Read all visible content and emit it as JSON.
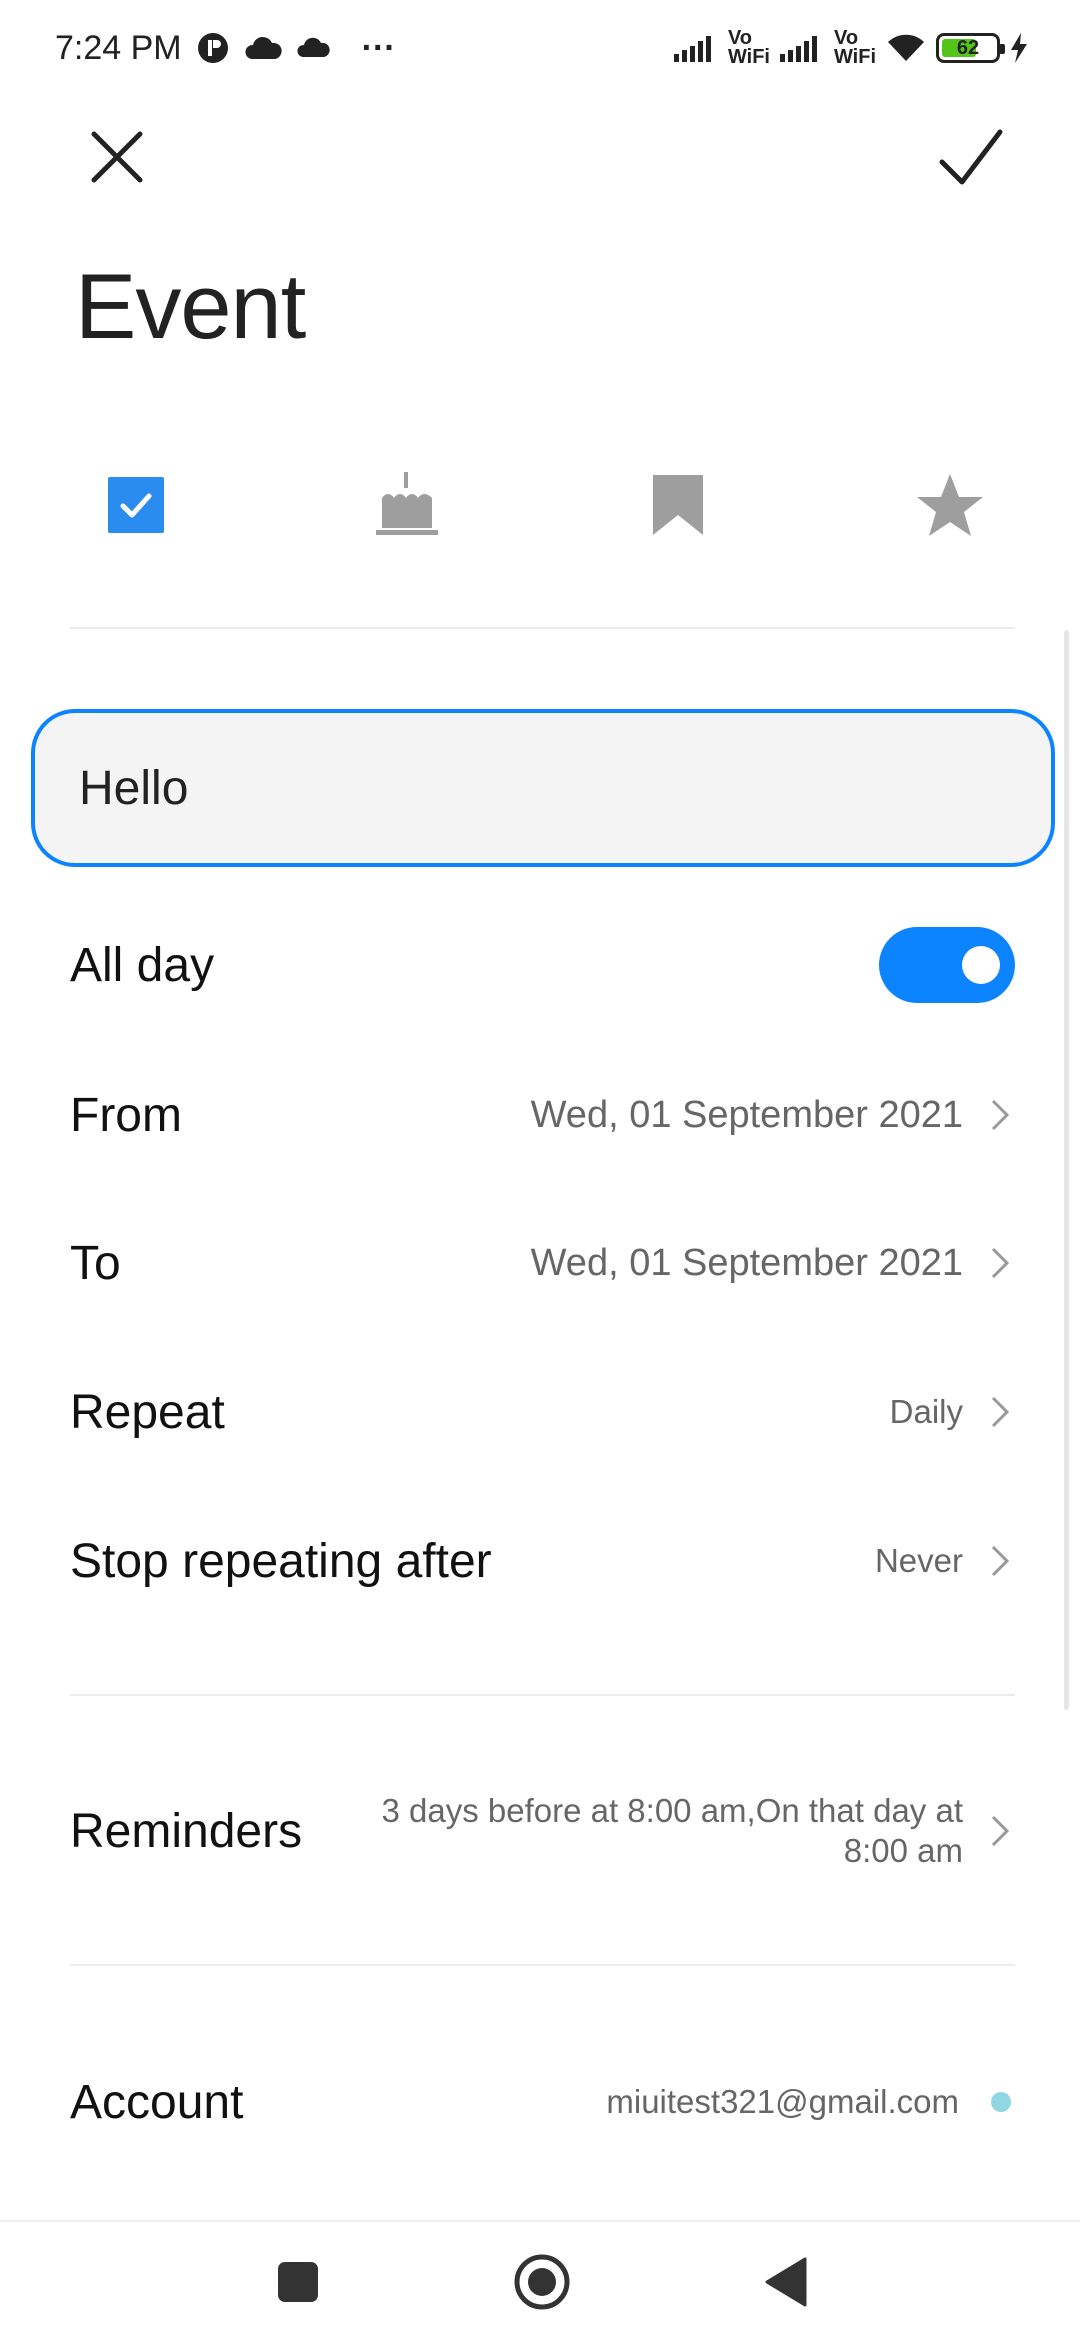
{
  "status_bar": {
    "time": "7:24 PM",
    "overflow": "···",
    "vowifi_1": "Vo\nWiFi",
    "vowifi_2": "Vo\nWiFi",
    "battery": "62"
  },
  "header": {
    "title": "Event"
  },
  "event_types": [
    "checklist-icon",
    "birthday-cake-icon",
    "bookmark-icon",
    "star-icon"
  ],
  "title_input": {
    "value": "Hello"
  },
  "rows": {
    "all_day": {
      "label": "All day",
      "enabled": true
    },
    "from": {
      "label": "From",
      "value": "Wed, 01 September 2021"
    },
    "to": {
      "label": "To",
      "value": "Wed, 01 September 2021"
    },
    "repeat": {
      "label": "Repeat",
      "value": "Daily"
    },
    "stop_repeating": {
      "label": "Stop repeating after",
      "value": "Never"
    },
    "reminders": {
      "label": "Reminders",
      "value": "3 days before at 8:00 am,On that day at 8:00 am"
    },
    "account": {
      "label": "Account",
      "value": "miuitest321@gmail.com"
    }
  },
  "colors": {
    "accent": "#0d84ff",
    "icon_gray": "#9e9e9e",
    "account_dot": "#8fd8e3"
  }
}
